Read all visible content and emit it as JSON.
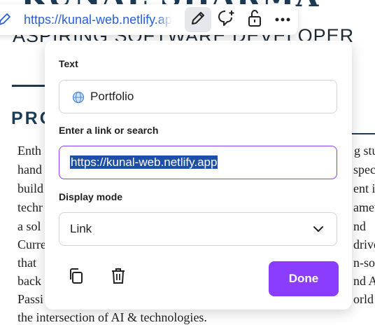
{
  "document": {
    "name": "KUNAL SHARMA",
    "role": "ASPIRING SOFTWARE DEVELOPER",
    "section_title": "PROFILE",
    "lines_left": [
      "Enth",
      "hand",
      "build",
      "techr",
      "a  sol",
      "Curre",
      "that",
      "back",
      "Passi",
      "the intersection of AI & technologies."
    ],
    "lines_right": [
      "g stu",
      "spec",
      "ent i",
      "amew",
      "nd",
      "drive",
      "n-sol",
      "nd A",
      "orld"
    ]
  },
  "toolbar": {
    "url": "https://kunal-web.netlify.app",
    "link_icon": "link-icon",
    "edit_icon": "pencil-icon",
    "comment_icon": "comment-add-icon",
    "lock_icon": "unlock-icon",
    "more_icon": "more-horizontal-icon"
  },
  "popover": {
    "text_label": "Text",
    "text_value": "Portfolio",
    "text_icon": "globe-icon",
    "link_label": "Enter a link or search",
    "link_value": "https://kunal-web.netlify.app",
    "display_label": "Display mode",
    "display_value": "Link",
    "copy_icon": "copy-icon",
    "delete_icon": "trash-icon",
    "done_label": "Done"
  },
  "colors": {
    "accent": "#8b3dff",
    "link": "#2b5fd9",
    "selection": "#1e4fa8",
    "heading": "#1d3a55"
  }
}
